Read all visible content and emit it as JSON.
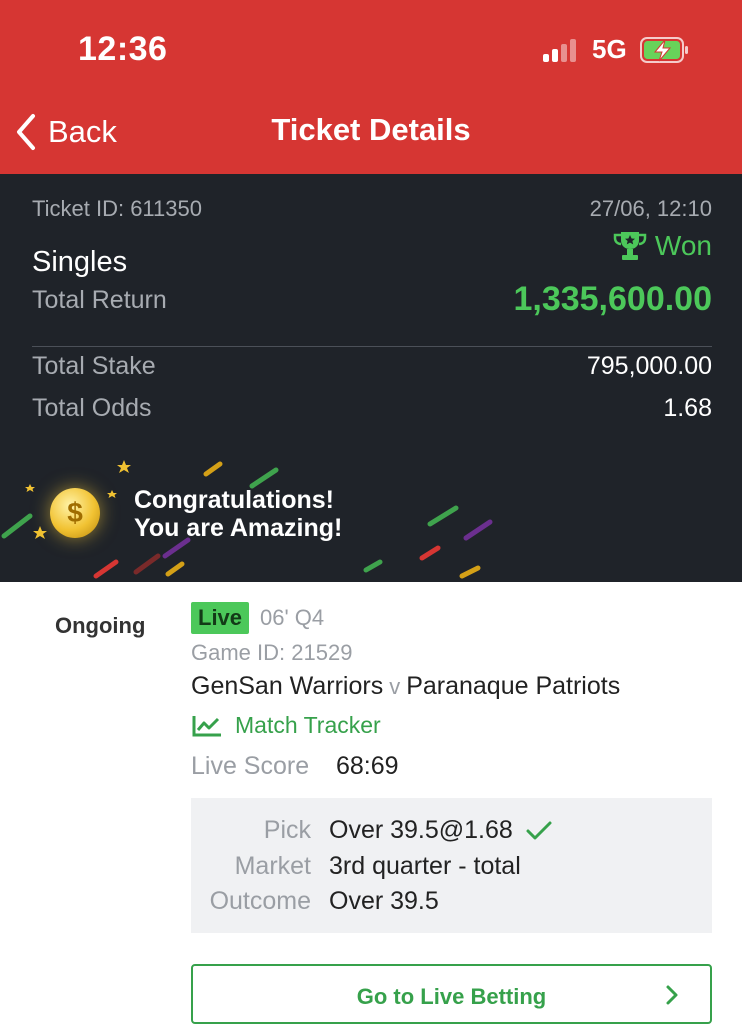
{
  "status_bar": {
    "time": "12:36",
    "network": "5G"
  },
  "nav": {
    "back_label": "Back",
    "title": "Ticket Details"
  },
  "summary": {
    "ticket_id": "Ticket ID: 611350",
    "date": "27/06, 12:10",
    "result": "Won",
    "bet_type": "Singles",
    "total_return_label": "Total Return",
    "total_return_value": "1,335,600.00",
    "total_stake_label": "Total Stake",
    "total_stake_value": "795,000.00",
    "total_odds_label": "Total Odds",
    "total_odds_value": "1.68",
    "congrats_line1": "Congratulations!",
    "congrats_line2": "You are Amazing!",
    "coin_symbol": "$"
  },
  "selection": {
    "status": "Ongoing",
    "live_badge": "Live",
    "period": "06' Q4",
    "game_id": "Game ID: 21529",
    "home": "GenSan Warriors",
    "vs": "v",
    "away": "Paranaque Patriots",
    "match_tracker": "Match Tracker",
    "live_score_label": "Live Score",
    "live_score_value": "68:69",
    "pick_label": "Pick",
    "pick_value": "Over 39.5@1.68",
    "market_label": "Market",
    "market_value": "3rd quarter - total",
    "outcome_label": "Outcome",
    "outcome_value": "Over 39.5"
  },
  "actions": {
    "go_live_label": "Go to Live Betting"
  },
  "colors": {
    "header_red": "#d63633",
    "dark_bg": "#1f2329",
    "win_green": "#4cc85a",
    "link_green": "#36a14b"
  }
}
